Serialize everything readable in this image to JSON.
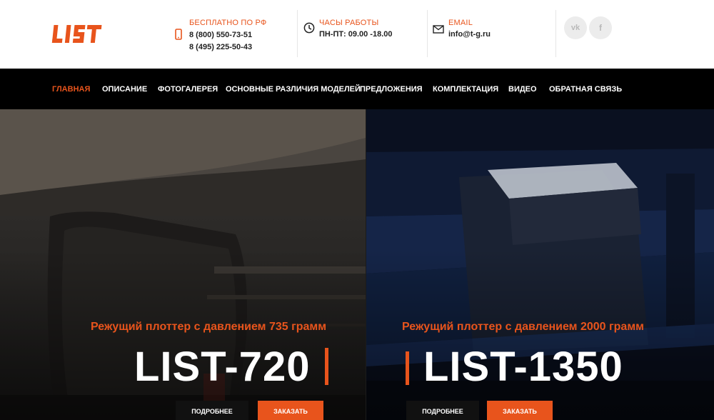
{
  "brand": {
    "logo_text": "LIST",
    "accent_color": "#e8541c"
  },
  "contacts": {
    "phone": {
      "icon": "mobile-phone-icon",
      "label": "БЕСПЛАТНО ПО РФ",
      "line1": "8 (800) 550-73-51",
      "line2": "8 (495) 225-50-43"
    },
    "hours": {
      "icon": "clock-icon",
      "label": "ЧАСЫ РАБОТЫ",
      "line1": "ПН-ПТ: 09.00 -18.00"
    },
    "email": {
      "icon": "envelope-icon",
      "label": "EMAIL",
      "line1": "info@t-g.ru"
    }
  },
  "socials": {
    "vk": "vk",
    "fb": "f"
  },
  "nav": {
    "items": [
      {
        "label": "ГЛАВНАЯ",
        "active": true
      },
      {
        "label": "ОПИСАНИЕ",
        "active": false
      },
      {
        "label": "ФОТОГАЛЕРЕЯ",
        "active": false
      },
      {
        "label": "ОСНОВНЫЕ РАЗЛИЧИЯ МОДЕЛЕЙ",
        "active": false
      },
      {
        "label": "ПРЕДЛОЖЕНИЯ",
        "active": false
      },
      {
        "label": "КОМПЛЕКТАЦИЯ",
        "active": false
      },
      {
        "label": "ВИДЕО",
        "active": false
      },
      {
        "label": "ОБРАТНАЯ СВЯЗЬ",
        "active": false
      }
    ]
  },
  "hero": {
    "left": {
      "subtitle": "Режущий плоттер с давлением 735 грамм",
      "model": "LIST-720",
      "more_button": "ПОДРОБНЕЕ",
      "order_button": "ЗАКАЗАТЬ"
    },
    "right": {
      "subtitle": "Режущий плоттер с давлением 2000 грамм",
      "model": "LIST-1350",
      "more_button": "ПОДРОБНЕЕ",
      "order_button": "ЗАКАЗАТЬ"
    }
  }
}
